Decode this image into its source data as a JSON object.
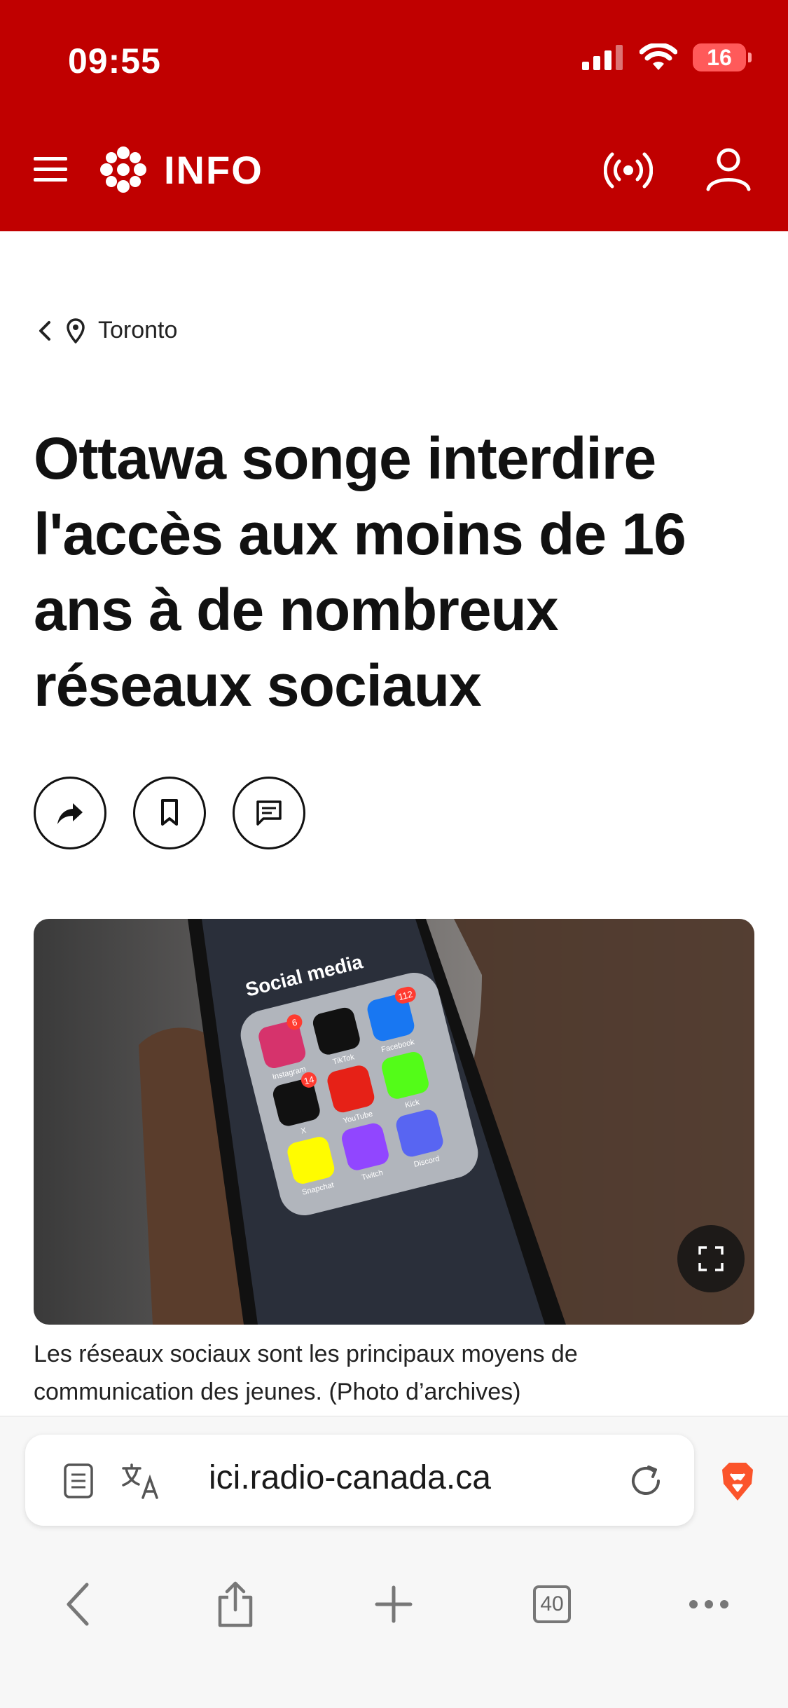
{
  "status_bar": {
    "time": "09:55",
    "battery": "16"
  },
  "header": {
    "logo_text": "INFO",
    "brand_color": "#c00000"
  },
  "breadcrumb": {
    "location": "Toronto"
  },
  "article": {
    "headline": "Ottawa songe interdire l'accès aux moins de 16 ans à de nombreux réseaux sociaux",
    "caption": "Les réseaux sociaux sont les principaux moyens de communication des jeunes. (Photo d’archives)"
  },
  "photo": {
    "folder_title": "Social media",
    "apps": [
      {
        "name": "Instagram",
        "badge": "6"
      },
      {
        "name": "TikTok",
        "badge": ""
      },
      {
        "name": "Facebook",
        "badge": "112"
      },
      {
        "name": "X",
        "badge": "14"
      },
      {
        "name": "YouTube",
        "badge": ""
      },
      {
        "name": "Kick",
        "badge": ""
      },
      {
        "name": "Snapchat",
        "badge": ""
      },
      {
        "name": "Twitch",
        "badge": ""
      },
      {
        "name": "Discord",
        "badge": ""
      }
    ]
  },
  "browser": {
    "url": "ici.radio-canada.ca",
    "tab_count": "40"
  },
  "icons": {
    "menu": "menu-icon",
    "logo": "gem-logo-icon",
    "radio": "radio-broadcast-icon",
    "user": "user-icon",
    "back": "chevron-left-icon",
    "location": "location-pin-icon",
    "share": "share-arrow-icon",
    "bookmark": "bookmark-icon",
    "comment": "comment-icon",
    "expand": "expand-icon",
    "reader": "reader-mode-icon",
    "translate": "translate-icon",
    "reload": "reload-icon",
    "brave": "brave-lion-icon"
  }
}
